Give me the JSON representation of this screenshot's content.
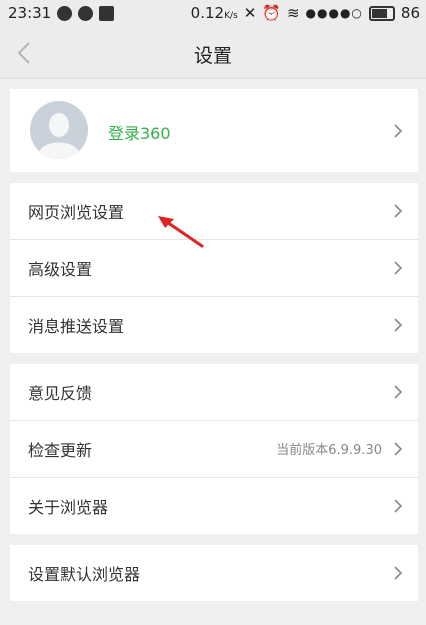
{
  "status": {
    "time": "23:31",
    "network_speed": "0.12",
    "network_unit": "K/s",
    "battery": "86"
  },
  "header": {
    "title": "设置"
  },
  "profile": {
    "login_label": "登录360"
  },
  "group1": {
    "items": [
      {
        "label": "网页浏览设置"
      },
      {
        "label": "高级设置"
      },
      {
        "label": "消息推送设置"
      }
    ]
  },
  "group2": {
    "items": [
      {
        "label": "意见反馈"
      },
      {
        "label": "检查更新",
        "value": "当前版本6.9.9.30"
      },
      {
        "label": "关于浏览器"
      }
    ]
  },
  "group3": {
    "items": [
      {
        "label": "设置默认浏览器"
      }
    ]
  },
  "colors": {
    "accent_green": "#37b24a",
    "annotation_red": "#e02222"
  }
}
